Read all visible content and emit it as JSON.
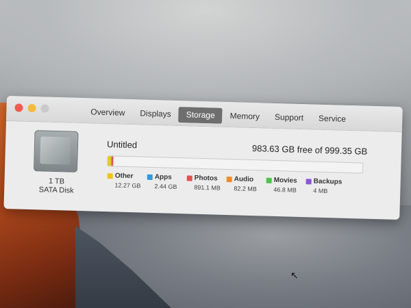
{
  "window": {
    "tabs": [
      {
        "label": "Overview"
      },
      {
        "label": "Displays"
      },
      {
        "label": "Storage"
      },
      {
        "label": "Memory"
      },
      {
        "label": "Support"
      },
      {
        "label": "Service"
      }
    ],
    "active_tab": "Storage"
  },
  "disk": {
    "capacity_label": "1 TB",
    "type_label": "SATA Disk",
    "icon": "hard-drive-icon"
  },
  "volume": {
    "name": "Untitled",
    "free_text": "983.63 GB free of 999.35 GB"
  },
  "usage": {
    "free_gb": 983.63,
    "total_gb": 999.35,
    "categories": [
      {
        "name": "Other",
        "size": "12.27 GB",
        "color": "#f0c419",
        "gb": 12.27
      },
      {
        "name": "Apps",
        "size": "2.44 GB",
        "color": "#2f9ae0",
        "gb": 2.44
      },
      {
        "name": "Photos",
        "size": "891.1 MB",
        "color": "#e2504e",
        "gb": 0.891
      },
      {
        "name": "Audio",
        "size": "82.2 MB",
        "color": "#f08a24",
        "gb": 0.082
      },
      {
        "name": "Movies",
        "size": "46.8 MB",
        "color": "#4cc24a",
        "gb": 0.047
      },
      {
        "name": "Backups",
        "size": "4 MB",
        "color": "#8a56d6",
        "gb": 0.004
      }
    ]
  }
}
